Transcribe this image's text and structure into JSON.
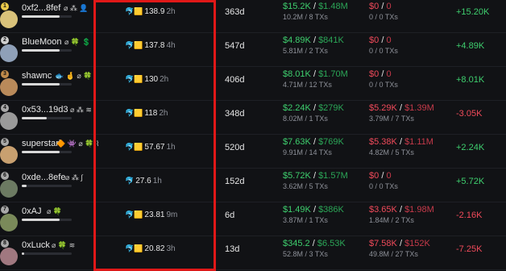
{
  "colors": {
    "buy": "#3ecf6e",
    "sell": "#f04a5a",
    "highlight": "#e01818",
    "background": "#111215"
  },
  "rows": [
    {
      "rank": "1",
      "name": "0xf2...8fef",
      "tags": "⌀ ⁂ 👤",
      "holding_icons": "🐬🟨",
      "holding": "138.9",
      "holding_ago": "2h",
      "age": "363d",
      "buy_usd": "$15.2K",
      "buy_sep": "/",
      "buy_sol": "$1.48M",
      "buy_sub": "10.2M / 8 TXs",
      "sell_usd": "$0",
      "sell_sep": "/",
      "sell_sol": "0",
      "sell_sub": "0 / 0 TXs",
      "pnl": "+15.20K",
      "bar_fill": 0.75
    },
    {
      "rank": "2",
      "name": "BlueMoon",
      "tags": "⌀ 🍀 💲",
      "holding_icons": "🐬🟨",
      "holding": "137.8",
      "holding_ago": "4h",
      "age": "547d",
      "buy_usd": "$4.89K",
      "buy_sep": "/",
      "buy_sol": "$841K",
      "buy_sub": "5.81M / 2 TXs",
      "sell_usd": "$0",
      "sell_sep": "/",
      "sell_sol": "0",
      "sell_sub": "0 / 0 TXs",
      "pnl": "+4.89K",
      "bar_fill": 0.75
    },
    {
      "rank": "3",
      "name": "shawnc",
      "tags": "🐟 🤞 ⌀ 🍀",
      "holding_icons": "🐬🟨",
      "holding": "130",
      "holding_ago": "2h",
      "age": "406d",
      "buy_usd": "$8.01K",
      "buy_sep": "/",
      "buy_sol": "$1.70M",
      "buy_sub": "4.71M / 12 TXs",
      "sell_usd": "$0",
      "sell_sep": "/",
      "sell_sol": "0",
      "sell_sub": "0 / 0 TXs",
      "pnl": "+8.01K",
      "bar_fill": 0.75
    },
    {
      "rank": "4",
      "name": "0x53...19d3",
      "tags": "⌀ ⁂ ≋",
      "holding_icons": "🐬🟨",
      "holding": "118",
      "holding_ago": "2h",
      "age": "348d",
      "buy_usd": "$2.24K",
      "buy_sep": "/",
      "buy_sol": "$279K",
      "buy_sub": "8.02M / 1 TXs",
      "sell_usd": "$5.29K",
      "sell_sep": "/",
      "sell_sol": "$1.39M",
      "sell_sub": "3.79M / 7 TXs",
      "pnl": "-3.05K",
      "bar_fill": 0.5
    },
    {
      "rank": "5",
      "name": "superstark",
      "tags": "🔶 👾 ⌀ 🍀 ⌇",
      "holding_icons": "🐬🟨",
      "holding": "57.67",
      "holding_ago": "1h",
      "age": "520d",
      "buy_usd": "$7.63K",
      "buy_sep": "/",
      "buy_sol": "$769K",
      "buy_sub": "9.91M / 14 TXs",
      "sell_usd": "$5.38K",
      "sell_sep": "/",
      "sell_sol": "$1.11M",
      "sell_sub": "4.82M / 5 TXs",
      "pnl": "+2.24K",
      "bar_fill": 0.75
    },
    {
      "rank": "6",
      "name": "0xde...8efe",
      "tags": "⌀ ⁂ ∫",
      "holding_icons": "🐬",
      "holding": "27.6",
      "holding_ago": "1h",
      "age": "152d",
      "buy_usd": "$5.72K",
      "buy_sep": "/",
      "buy_sol": "$1.57M",
      "buy_sub": "3.62M / 5 TXs",
      "sell_usd": "$0",
      "sell_sep": "/",
      "sell_sol": "0",
      "sell_sub": "0 / 0 TXs",
      "pnl": "+5.72K",
      "bar_fill": 0.1
    },
    {
      "rank": "7",
      "name": "0xAJ",
      "tags": "⌀       🍀",
      "holding_icons": "🐬🟨",
      "holding": "23.81",
      "holding_ago": "9m",
      "age": "6d",
      "buy_usd": "$1.49K",
      "buy_sep": "/",
      "buy_sol": "$386K",
      "buy_sub": "3.87M / 1 TXs",
      "sell_usd": "$3.65K",
      "sell_sep": "/",
      "sell_sol": "$1.98M",
      "sell_sub": "1.84M / 2 TXs",
      "pnl": "-2.16K",
      "bar_fill": 0.75
    },
    {
      "rank": "8",
      "name": "0xLuck",
      "tags": "⌀       🍀 ≋",
      "holding_icons": "🐬🟨",
      "holding": "20.82",
      "holding_ago": "3h",
      "age": "13d",
      "buy_usd": "$345.2",
      "buy_sep": "/",
      "buy_sol": "$6.53K",
      "buy_sub": "52.8M / 3 TXs",
      "sell_usd": "$7.58K",
      "sell_sep": "/",
      "sell_sol": "$152K",
      "sell_sub": "49.8M / 27 TXs",
      "pnl": "-7.25K",
      "bar_fill": 0.05
    }
  ]
}
